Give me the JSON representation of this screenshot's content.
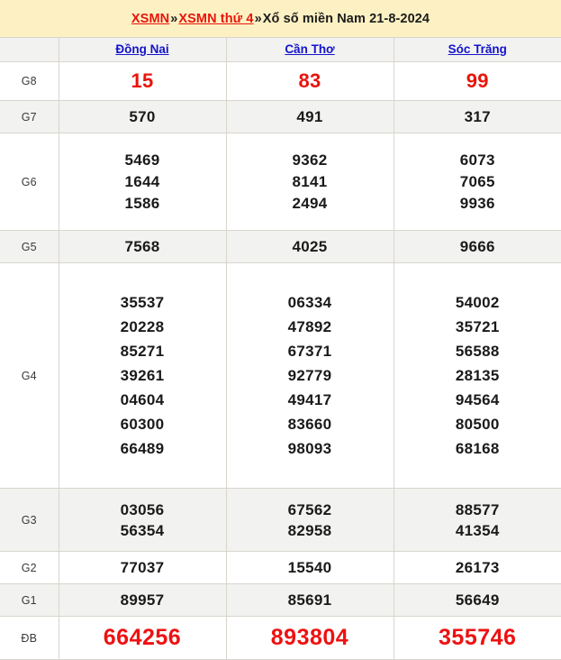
{
  "banner": {
    "crumb1": "XSMN",
    "separator1": "»",
    "crumb2": "XSMN thứ 4",
    "separator2": "»",
    "title": "Xổ số miền Nam 21-8-2024"
  },
  "colors": {
    "banner_background": "#fdf1c3",
    "crumb_link": "#e8140b",
    "province_link": "#1414cc",
    "special_prize": "#ee1111",
    "g8_prize": "#e8140b",
    "number_text": "#1a1a1a",
    "row_shade": "#f2f2f0",
    "border": "#d9d5cd"
  },
  "table": {
    "corner_label": "",
    "provinces": [
      "Đồng Nai",
      "Cần Thơ",
      "Sóc Trăng"
    ],
    "rows": [
      {
        "label": "G8",
        "style": "red-small",
        "shaded": false,
        "values": [
          [
            "15"
          ],
          [
            "83"
          ],
          [
            "99"
          ]
        ]
      },
      {
        "label": "G7",
        "style": "normal",
        "shaded": true,
        "values": [
          [
            "570"
          ],
          [
            "491"
          ],
          [
            "317"
          ]
        ]
      },
      {
        "label": "G6",
        "style": "normal",
        "shaded": false,
        "values": [
          [
            "5469",
            "1644",
            "1586"
          ],
          [
            "9362",
            "8141",
            "2494"
          ],
          [
            "6073",
            "7065",
            "9936"
          ]
        ]
      },
      {
        "label": "G5",
        "style": "normal",
        "shaded": true,
        "values": [
          [
            "7568"
          ],
          [
            "4025"
          ],
          [
            "9666"
          ]
        ]
      },
      {
        "label": "G4",
        "style": "normal",
        "shaded": false,
        "values": [
          [
            "35537",
            "20228",
            "85271",
            "39261",
            "04604",
            "60300",
            "66489"
          ],
          [
            "06334",
            "47892",
            "67371",
            "92779",
            "49417",
            "83660",
            "98093"
          ],
          [
            "54002",
            "35721",
            "56588",
            "28135",
            "94564",
            "80500",
            "68168"
          ]
        ]
      },
      {
        "label": "G3",
        "style": "normal",
        "shaded": true,
        "values": [
          [
            "03056",
            "56354"
          ],
          [
            "67562",
            "82958"
          ],
          [
            "88577",
            "41354"
          ]
        ]
      },
      {
        "label": "G2",
        "style": "normal",
        "shaded": false,
        "values": [
          [
            "77037"
          ],
          [
            "15540"
          ],
          [
            "26173"
          ]
        ]
      },
      {
        "label": "G1",
        "style": "normal",
        "shaded": true,
        "values": [
          [
            "89957"
          ],
          [
            "85691"
          ],
          [
            "56649"
          ]
        ]
      },
      {
        "label": "ĐB",
        "style": "red-big",
        "shaded": false,
        "values": [
          [
            "664256"
          ],
          [
            "893804"
          ],
          [
            "355746"
          ]
        ]
      }
    ]
  }
}
